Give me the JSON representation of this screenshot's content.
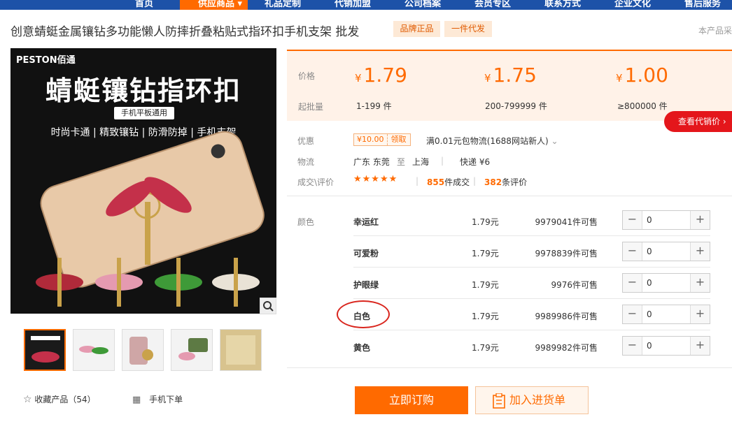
{
  "nav": {
    "items": [
      "首页",
      "供应商品",
      "礼品定制",
      "代销加盟",
      "公司档案",
      "会员专区",
      "联系方式",
      "企业文化",
      "售后服务"
    ],
    "active_label": "供应商品 ▾"
  },
  "product": {
    "title": "创意蜻蜓金属镶钻多功能懒人防摔折叠粘贴式指环扣手机支架 批发",
    "badges": [
      "品牌正品",
      "一件代发"
    ],
    "topright": "本产品采"
  },
  "image": {
    "brand": "PESTON佰通",
    "headline": "蜻蜓镶钻指环扣",
    "tag": "手机平板通用",
    "subline": "时尚卡通 | 精致镶钻 | 防滑防掉 | 手机支架",
    "thumbnail_count": 5
  },
  "actions_left": {
    "favorite_label": "收藏产品（54）",
    "mobile_label": "手机下单"
  },
  "pricing": {
    "price_label": "价格",
    "qty_label": "起批量",
    "currency": "¥",
    "tiers": [
      {
        "price": "1.79",
        "qty": "1-199 件"
      },
      {
        "price": "1.75",
        "qty": "200-799999 件"
      },
      {
        "price": "1.00",
        "qty": "≥800000 件"
      }
    ],
    "dealer_button": "查看代销价"
  },
  "info": {
    "discount_label": "优惠",
    "coupon_amount": "¥10.00",
    "coupon_action": "领取",
    "shipping_promo": "满0.01元包物流(1688网站新人)",
    "logistics_label": "物流",
    "from": "广东 东莞",
    "to_word": "至",
    "to": "上海",
    "express": "快递 ¥6",
    "deals_label": "成交\\评价",
    "stars": "★★★★★",
    "sold_count": "855",
    "sold_suffix": "件成交",
    "review_count": "382",
    "review_suffix": "条评价"
  },
  "sku": {
    "label": "颜色",
    "rows": [
      {
        "name": "幸运红",
        "price": "1.79元",
        "stock": "9979041件可售",
        "qty": "0"
      },
      {
        "name": "可爱粉",
        "price": "1.79元",
        "stock": "9978839件可售",
        "qty": "0"
      },
      {
        "name": "护眼绿",
        "price": "1.79元",
        "stock": "9976件可售",
        "qty": "0"
      },
      {
        "name": "白色",
        "price": "1.79元",
        "stock": "9989986件可售",
        "qty": "0"
      },
      {
        "name": "黄色",
        "price": "1.79元",
        "stock": "9989982件可售",
        "qty": "0"
      }
    ]
  },
  "buttons": {
    "buy_now": "立即订购",
    "add_cart": "加入进货单"
  },
  "colors": {
    "accent": "#ff6a00",
    "nav_bg": "#1d52a8",
    "dealer_red": "#e4161b",
    "highlight_circle": "#d9251d"
  }
}
